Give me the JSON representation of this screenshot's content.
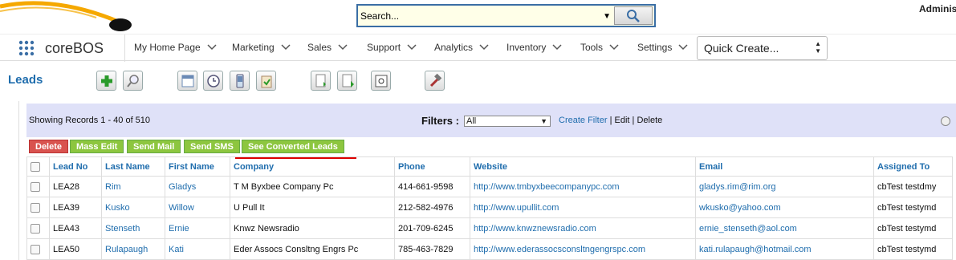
{
  "search": {
    "value": "Search..."
  },
  "user": {
    "name": "Adminis"
  },
  "brand": {
    "name": "coreBOS"
  },
  "nav": {
    "items": [
      "My Home Page",
      "Marketing",
      "Sales",
      "Support",
      "Analytics",
      "Inventory",
      "Tools",
      "Settings"
    ],
    "quick_create": "Quick Create..."
  },
  "module": {
    "title": "Leads"
  },
  "list": {
    "showing": "Showing Records 1 - 40 of 510",
    "filters_label": "Filters :",
    "filter_value": "All",
    "create_filter": "Create Filter",
    "sep1": " | ",
    "edit": "Edit",
    "sep2": " | ",
    "delete": "Delete"
  },
  "actions": {
    "delete": "Delete",
    "mass_edit": "Mass Edit",
    "send_mail": "Send Mail",
    "send_sms": "Send SMS",
    "see_converted": "See Converted Leads"
  },
  "columns": [
    "Lead No",
    "Last Name",
    "First Name",
    "Company",
    "Phone",
    "Website",
    "Email",
    "Assigned To"
  ],
  "rows": [
    [
      "LEA28",
      "Rim",
      "Gladys",
      "T M Byxbee Company Pc",
      "414-661-9598",
      "http://www.tmbyxbeecompanypc.com",
      "gladys.rim@rim.org",
      "cbTest testdmy"
    ],
    [
      "LEA39",
      "Kusko",
      "Willow",
      "U Pull It",
      "212-582-4976",
      "http://www.upullit.com",
      "wkusko@yahoo.com",
      "cbTest testymd"
    ],
    [
      "LEA43",
      "Stenseth",
      "Ernie",
      "Knwz Newsradio",
      "201-709-6245",
      "http://www.knwznewsradio.com",
      "ernie_stenseth@aol.com",
      "cbTest testymd"
    ],
    [
      "LEA50",
      "Rulapaugh",
      "Kati",
      "Eder Assocs Consltng Engrs Pc",
      "785-463-7829",
      "http://www.ederassocsconsltngengrspc.com",
      "kati.rulapaugh@hotmail.com",
      "cbTest testymd"
    ]
  ]
}
